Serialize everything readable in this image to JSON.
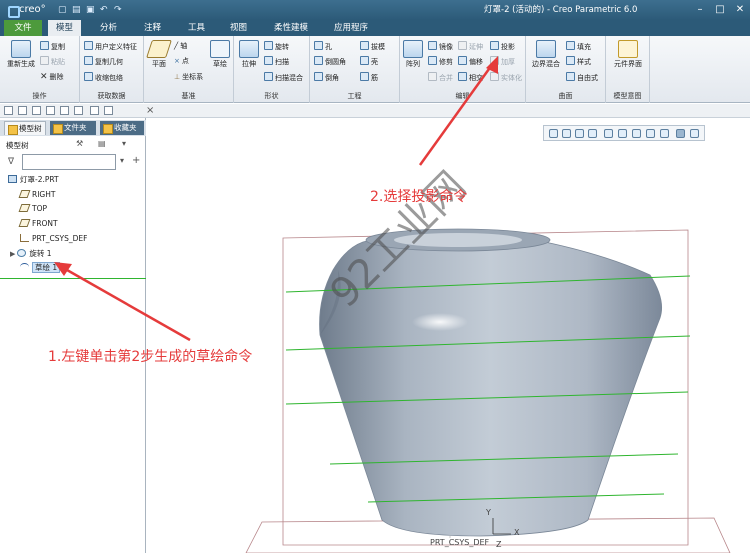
{
  "titlebar": {
    "logo": "creo°",
    "window_title": "灯罩-2 (活动的) - Creo Parametric 6.0"
  },
  "menu": {
    "file": "文件",
    "tabs": [
      "模型",
      "分析",
      "注释",
      "工具",
      "视图",
      "柔性建模",
      "应用程序"
    ]
  },
  "ribbon": {
    "operations": {
      "regen": "重新生成",
      "copy": "复制",
      "paste": "粘贴",
      "delete": "删除",
      "label": "操作"
    },
    "get_data": {
      "udf": "用户定义特征",
      "copy_geom": "复制几何",
      "shrinkwrap": "收缩包络",
      "label": "获取数据"
    },
    "datum": {
      "plane": "平面",
      "axis": "轴",
      "point": "点",
      "csys": "坐标系",
      "sketch": "草绘",
      "label": "基准"
    },
    "shapes": {
      "extrude": "拉伸",
      "revolve": "旋转",
      "sweep": "扫描",
      "swept_blend": "扫描混合",
      "label": "形状"
    },
    "engineering": {
      "hole": "孔",
      "round": "倒圆角",
      "chamfer": "倒角",
      "draft": "拔模",
      "shell": "壳",
      "rib": "筋",
      "label": "工程"
    },
    "editing": {
      "pattern": "阵列",
      "mirror": "镜像",
      "extend": "延伸",
      "project": "投影",
      "trim": "修剪",
      "offset": "偏移",
      "thicken": "加厚",
      "merge": "合并",
      "intersect": "相交",
      "solidify": "实体化",
      "label": "编辑"
    },
    "surfaces": {
      "boundary_blend": "边界混合",
      "fill": "填充",
      "style": "样式",
      "freestyle": "自由式",
      "label": "曲面"
    },
    "model_intent": {
      "component_interface": "元件界面",
      "label": "模型意图"
    }
  },
  "left_panel": {
    "tabs": [
      "模型树",
      "文件夹",
      "收藏夹"
    ],
    "tree_header": "模型树",
    "tree": [
      {
        "label": "灯罩-2.PRT",
        "kind": "part"
      },
      {
        "label": "RIGHT",
        "kind": "plane"
      },
      {
        "label": "TOP",
        "kind": "plane"
      },
      {
        "label": "FRONT",
        "kind": "plane"
      },
      {
        "label": "PRT_CSYS_DEF",
        "kind": "csys"
      },
      {
        "label": "旋转 1",
        "kind": "revolve"
      },
      {
        "label": "草绘 1",
        "kind": "sketch",
        "selected": true
      }
    ]
  },
  "graphics": {
    "watermark": "92工业网",
    "csys_label": "PRT_CSYS_DEF",
    "axis_x": "X",
    "axis_y": "Y",
    "axis_z": "Z",
    "annotation_1": "1.左键单击第2步生成的草绘命令",
    "annotation_2": "2.选择投影命令"
  },
  "colors": {
    "accent_red": "#e53b3b",
    "title_blue": "#2c5a78",
    "file_green": "#4d9a3c",
    "sketch_green": "#2fb52f",
    "body_gray": "#aab4c0"
  }
}
